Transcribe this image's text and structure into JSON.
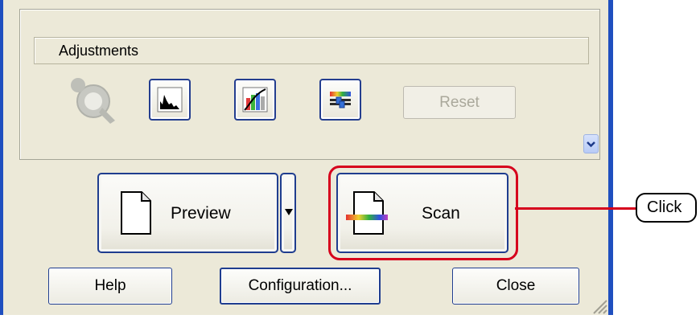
{
  "adjustments": {
    "title": "Adjustments",
    "reset_label": "Reset"
  },
  "buttons": {
    "preview_label": "Preview",
    "scan_label": "Scan",
    "help_label": "Help",
    "configuration_label": "Configuration...",
    "close_label": "Close"
  },
  "callout": {
    "label": "Click"
  },
  "icons": [
    "auto-exposure-icon",
    "histogram-icon",
    "tone-curve-icon",
    "color-palette-icon",
    "chevron-down-icon",
    "document-icon",
    "scan-document-icon",
    "dropdown-arrow-icon"
  ],
  "colors": {
    "window_border": "#1f4fbf",
    "highlight": "#d6001c",
    "button_border": "#1f3d8f"
  }
}
